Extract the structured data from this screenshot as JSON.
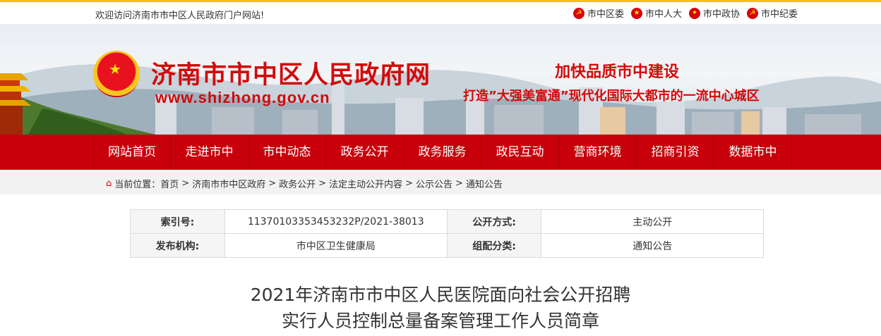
{
  "topbar": {
    "welcome": "欢迎访问济南市市中区人民政府门户网站!",
    "links": [
      {
        "label": "市中区委",
        "icon": "party-emblem-icon"
      },
      {
        "label": "市中人大",
        "icon": "national-emblem-icon"
      },
      {
        "label": "市中政协",
        "icon": "cppcc-emblem-icon"
      },
      {
        "label": "市中纪委",
        "icon": "party-emblem-icon"
      }
    ]
  },
  "banner": {
    "title": "济南市市中区人民政府网",
    "url": "www.shizhong.gov.cn",
    "slogan1": "加快品质市中建设",
    "slogan2": "打造”大强美富通”现代化国际大都市的一流中心城区"
  },
  "nav": {
    "items": [
      "网站首页",
      "走进市中",
      "市中动态",
      "政务公开",
      "政务服务",
      "政民互动",
      "营商环境",
      "招商引资",
      "数据市中"
    ]
  },
  "breadcrumb": {
    "prefix": "当前位置：",
    "items": [
      "首页",
      "济南市市中区政府",
      "政务公开",
      "法定主动公开内容",
      "公示公告",
      "通知公告"
    ],
    "separator": ">"
  },
  "info": {
    "index_label": "索引号:",
    "index_value": "11370103353453232P/2021-38013",
    "method_label": "公开方式:",
    "method_value": "主动公开",
    "org_label": "发布机构:",
    "org_value": "市中区卫生健康局",
    "category_label": "组配分类:",
    "category_value": "通知公告"
  },
  "document": {
    "title_line1": "2021年济南市市中区人民医院面向社会公开招聘",
    "title_line2": "实行人员控制总量备案管理工作人员简章"
  },
  "colors": {
    "brand_red": "#c8000b",
    "title_red": "#d20a0a",
    "accent_yellow": "#f2c40f"
  }
}
